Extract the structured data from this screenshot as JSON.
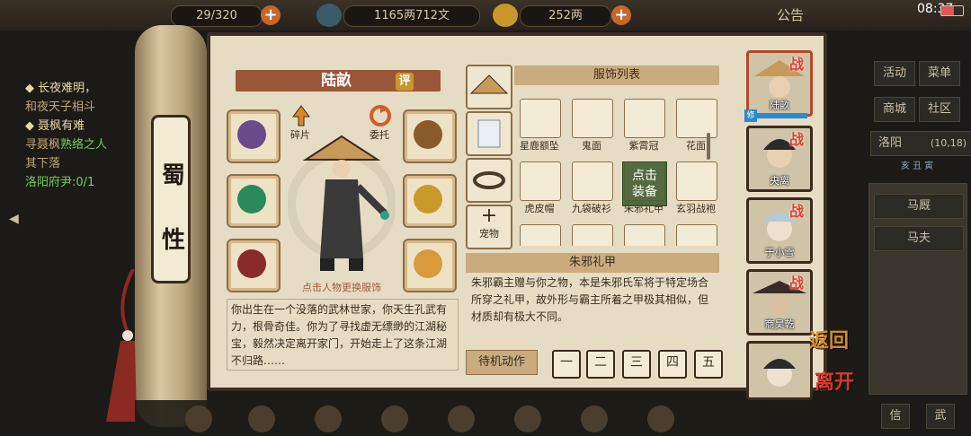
{
  "topbar": {
    "capacity": "29/320",
    "money": "1165两712文",
    "gold": "252两",
    "announcement": "公告",
    "time": "08:37"
  },
  "quest": {
    "line1": "◆ 长夜难明，",
    "line2": "和夜天子相斗",
    "line3": "◆ 聂枫有难",
    "line4a": "寻聂枫",
    "line4b": "熟络之人",
    "line5": "其下落",
    "line6": "洛阳府尹:0/1"
  },
  "scroll": {
    "chars": [
      "蜀",
      "性"
    ]
  },
  "character": {
    "name": "陆畝",
    "rate_badge": "评",
    "fragments_label": "碎片",
    "entrust_label": "委托",
    "hint": "点击人物更换服饰",
    "bio": "你出生在一个没落的武林世家，你天生孔武有力，根骨奇佳。你为了寻找虚无缥缈的江湖秘宝，毅然决定离开家门，开始走上了这条江湖不归路……"
  },
  "costume": {
    "pet_label": "宠物",
    "list_title": "服饰列表",
    "items": [
      "星鹿额坠",
      "鬼面",
      "紫霄冠",
      "花面",
      "虎皮帽",
      "九袋破衫",
      "朱邪礼甲",
      "玄羽战袍"
    ],
    "equip_popup_line1": "点击",
    "equip_popup_line2": "装备",
    "selected_title": "朱邪礼甲",
    "selected_desc": "朱邪霸主赠与你之物，本是朱邪氏军将于特定场合所穿之礼甲，故外形与霸主所着之甲极其相似，但材质却有极大不同。",
    "idle_action_label": "待机动作",
    "poses": [
      "一",
      "二",
      "三",
      "四",
      "五"
    ]
  },
  "roster": {
    "heroes": [
      "陆畝",
      "央离",
      "于小雪",
      "商昊乾",
      ""
    ],
    "war_mark": "战",
    "level_badge": "修"
  },
  "actions": {
    "back": "返回",
    "leave": "离开"
  },
  "rightmenu": {
    "activity": "活动",
    "menu": "菜单",
    "shop": "商城",
    "community": "社区",
    "location": "洛阳",
    "coords": "(10,18)",
    "time_slot": "亥 丑 寅",
    "stable": "马厩",
    "groom": "马夫",
    "bottom_left": "信",
    "bottom_right": "武"
  }
}
